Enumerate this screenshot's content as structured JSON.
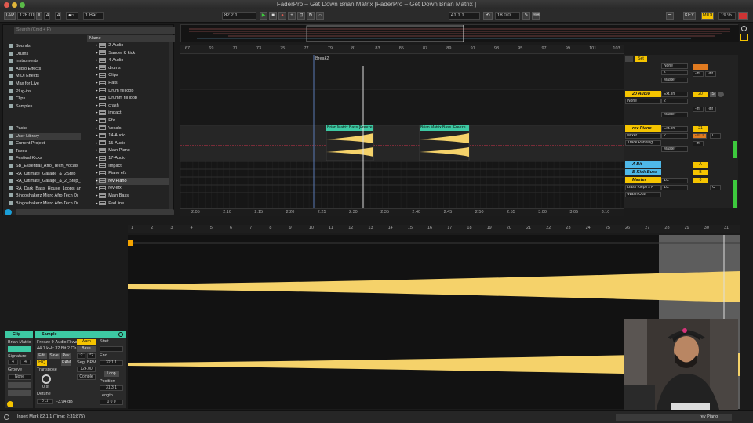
{
  "window": {
    "title": "FaderPro – Get Down Brian Matrix  [FaderPro – Get Down Brian Matrix ]"
  },
  "transport": {
    "tap": "TAP",
    "tempo": "128.00",
    "signature_num": "4",
    "signature_den": "4",
    "metro": "●○",
    "quantize": "1 Bar",
    "position": "82   2   1",
    "loop_start": "41   1   1",
    "loop_length": "18   0   0",
    "key_label": "KEY",
    "midi_label": "MIDI",
    "cpu": "19 %",
    "accent": "#f5c400"
  },
  "browser": {
    "search_placeholder": "Search (Cmd + F)",
    "categories": [
      {
        "label": "Sounds",
        "icon": "sounds-icon"
      },
      {
        "label": "Drums",
        "icon": "drums-icon"
      },
      {
        "label": "Instruments",
        "icon": "instruments-icon"
      },
      {
        "label": "Audio Effects",
        "icon": "audio-effects-icon"
      },
      {
        "label": "MIDI Effects",
        "icon": "midi-effects-icon"
      },
      {
        "label": "Max for Live",
        "icon": "max-icon"
      },
      {
        "label": "Plug-ins",
        "icon": "plugin-icon"
      },
      {
        "label": "Clips",
        "icon": "clips-icon"
      },
      {
        "label": "Samples",
        "icon": "samples-icon"
      }
    ],
    "places": [
      {
        "label": "Packs"
      },
      {
        "label": "User Library"
      },
      {
        "label": "Current Project"
      },
      {
        "label": "Taxes"
      },
      {
        "label": "Festival Kicks"
      },
      {
        "label": "SB_Essential_Afro_Tech_Vocals"
      },
      {
        "label": "RA_Ultimate_Garage_&_2Step"
      },
      {
        "label": "RA_Ultimate_Garage_&_2_Step_V"
      },
      {
        "label": "RA_Dark_Bass_House_Loops_an"
      },
      {
        "label": "Bingoshakerz Micro Afro Tech Dr"
      },
      {
        "label": "Bingoshakerz Micro Afro Tech Dr"
      }
    ],
    "name_header": "Name",
    "files": [
      "2-Audio",
      "Sander K kick",
      "4-Audio",
      "drums",
      "Clips",
      "Hats",
      "Drum fill loop",
      "Drumm fill loop",
      "crash",
      "impact",
      "Efx",
      "Vocals",
      "14-Audio",
      "15-Audio",
      "Main Piano",
      "17-Audio",
      "Impact",
      "Piano efx",
      "rev Piano",
      "rev efx",
      "Main Bass",
      "Pad line"
    ],
    "selected_file_index": 18
  },
  "arrangement": {
    "bar_numbers": [
      "67",
      "69",
      "71",
      "73",
      "75",
      "77",
      "79",
      "81",
      "83",
      "85",
      "87",
      "89",
      "91",
      "93",
      "95",
      "97",
      "99",
      "101",
      "103"
    ],
    "locator": "Break2",
    "clip_names": [
      "Brian Matrix Bass [Freeze",
      "Brian Matrix Bass [Freeze"
    ],
    "time_labels": [
      "2:05",
      "2:10",
      "2:15",
      "2:20",
      "2:25",
      "2:30",
      "2:35",
      "2:40",
      "2:45",
      "2:50",
      "2:55",
      "3:00",
      "3:05",
      "3:10"
    ]
  },
  "mixer": {
    "tracks": [
      {
        "name": "",
        "input": "None",
        "num": "2",
        "monitor": "Master",
        "db1": "-inf",
        "db2": "-inf"
      },
      {
        "name": "20 Audio",
        "input": "Ext. In",
        "input2": "None",
        "num": "2",
        "monitor": "Master",
        "track_num": "20",
        "db1": "-inf",
        "db2": "-inf"
      },
      {
        "name": "rev Piano",
        "input": "Ext. In",
        "input2": "Mixer",
        "input3": "Track Panning",
        "num": "2",
        "monitor": "Master",
        "track_num": "21",
        "db1": "-10.1",
        "db2": "-inf",
        "pan": "C"
      },
      {
        "name": "A Bit",
        "track_num": "A"
      },
      {
        "name": "B Kick Buss",
        "track_num": "B"
      },
      {
        "name": "Master",
        "sub1": "Bass Kleph's F",
        "sub2": "Wash Out!",
        "ratio": "1/2",
        "ratio2": "1/2",
        "track_num": "0",
        "pan": "C"
      }
    ],
    "set_label": "Set"
  },
  "detail": {
    "bar_numbers": [
      "1",
      "2",
      "3",
      "4",
      "5",
      "6",
      "7",
      "8",
      "9",
      "10",
      "11",
      "12",
      "13",
      "14",
      "15",
      "16",
      "17",
      "18",
      "19",
      "20",
      "21",
      "22",
      "23",
      "24",
      "25",
      "26",
      "27",
      "28",
      "29",
      "30",
      "31"
    ]
  },
  "clip": {
    "header": "Clip",
    "name": "Brian Matrix",
    "signature_label": "Signature",
    "sig_num": "4",
    "sig_den": "4",
    "groove_label": "Groove",
    "groove_value": "None",
    "color": "#3dc9a3"
  },
  "sample": {
    "header": "Sample",
    "file": "Freeze 9-Audio R.wa",
    "format": "44.1 kHz 32 Bit 2 Ch",
    "edit": "Edit",
    "save": "Save",
    "rev": "Rev.",
    "hiq": "HiQ",
    "ram": "RAM",
    "transpose_label": "Transpose",
    "transpose_value": "0 st",
    "detune_label": "Detune",
    "detune_value": "0 ct",
    "gain_value": "-3.94 dB",
    "warp": "Warp",
    "seg_bpm_label": "Seg. BPM",
    "seg_bpm_value": "124.00",
    "half": ":2",
    "double": "*2",
    "mode": "Comple",
    "start_label": "Start",
    "end_label": "End",
    "end_value": "32   1   1",
    "loop_label": "Loop",
    "position_label": "Position",
    "position_value": "31   3   1",
    "length_label": "Length",
    "length_value": "0   0   0",
    "base": "Base",
    "loop_btn": "Loop"
  },
  "status": {
    "message": "Insert Mark 82.1.1 (Time: 2:31:875)",
    "track": "rev Piano"
  }
}
